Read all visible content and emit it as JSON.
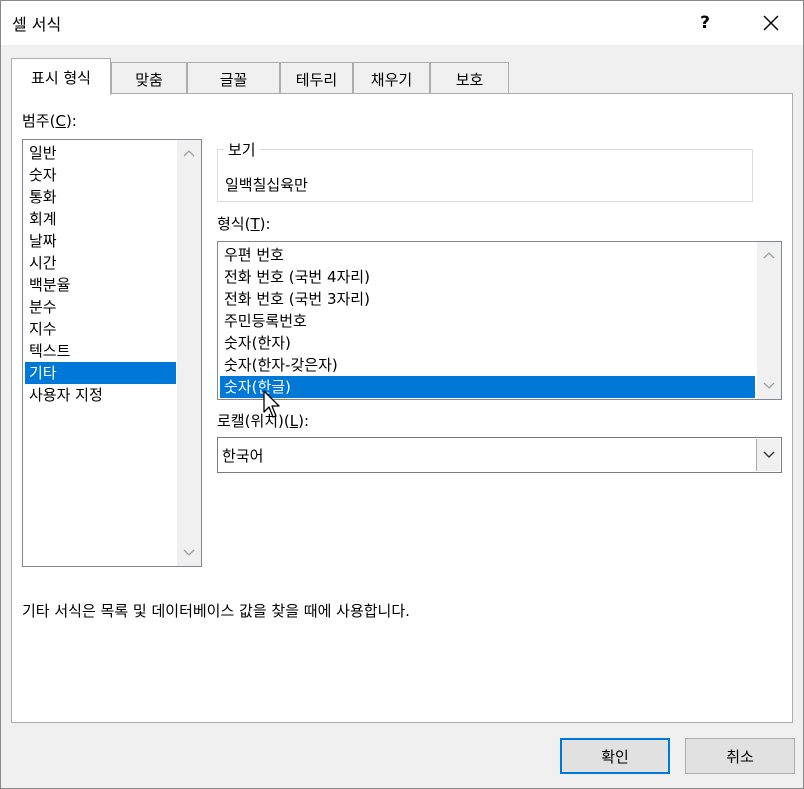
{
  "window": {
    "title": "셀 서식",
    "help_label": "?"
  },
  "tabs": [
    {
      "label": "표시 형식",
      "active": true
    },
    {
      "label": "맞춤"
    },
    {
      "label": "글꼴"
    },
    {
      "label": "테두리"
    },
    {
      "label": "채우기"
    },
    {
      "label": "보호"
    }
  ],
  "category": {
    "label_prefix": "범주(",
    "label_key": "C",
    "label_suffix": "):",
    "items": [
      "일반",
      "숫자",
      "통화",
      "회계",
      "날짜",
      "시간",
      "백분율",
      "분수",
      "지수",
      "텍스트",
      "기타",
      "사용자 지정"
    ],
    "selected_index": 10
  },
  "sample": {
    "legend": "보기",
    "value": "일백칠십육만"
  },
  "format": {
    "label_prefix": "형식(",
    "label_key": "T",
    "label_suffix": "):",
    "items": [
      "우편 번호",
      "전화 번호 (국번 4자리)",
      "전화 번호 (국번 3자리)",
      "주민등록번호",
      "숫자(한자)",
      "숫자(한자-갖은자)",
      "숫자(한글)"
    ],
    "selected_index": 6
  },
  "locale": {
    "label_prefix": "로캘(위치)(",
    "label_key": "L",
    "label_suffix": "):",
    "value": "한국어"
  },
  "description": "기타 서식은 목록 및 데이터베이스 값을 찾을 때에 사용합니다.",
  "buttons": {
    "ok": "확인",
    "cancel": "취소"
  },
  "colors": {
    "selection": "#0078d7",
    "default_button_border": "#0078d7"
  }
}
